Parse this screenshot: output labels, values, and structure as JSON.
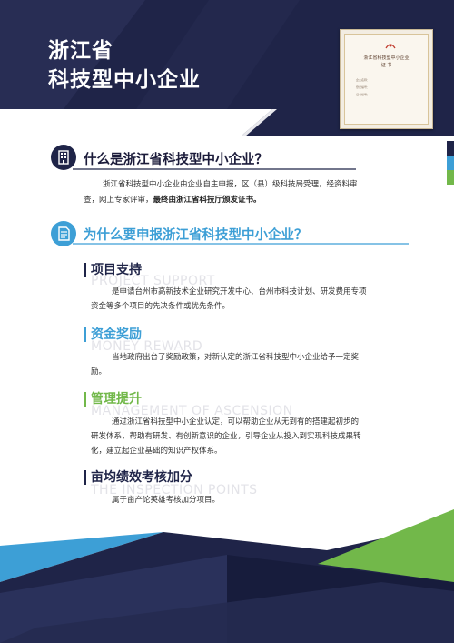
{
  "header": {
    "title_line1": "浙江省",
    "title_line2": "科技型中小企业"
  },
  "certificate": {
    "title": "浙江省科技型中小企业",
    "subtitle": "证 书",
    "line1_label": "企业名称：",
    "line2_label": "登记编号：",
    "line3_label": "证书编号："
  },
  "section1": {
    "heading": "什么是浙江省科技型中小企业？",
    "body_line1": "浙江省科技型中小企业由企业自主申报，区（县）级科技局受理，经资料审",
    "body_line2_prefix": "查，网上专家评审，",
    "body_line2_bold": "最终由浙江省科技厅颁发证书。"
  },
  "section2": {
    "heading": "为什么要申报浙江省科技型中小企业？",
    "items": [
      {
        "title": "项目支持",
        "ghost": "PROJECT SUPPORT",
        "lines": [
          "是申请台州市高新技术企业研究开发中心、台州市科技计划、研发费用专项",
          "资金等多个项目的先决条件或优先条件。"
        ]
      },
      {
        "title": "资金奖励",
        "ghost": "MONEY REWARD",
        "lines": [
          "当地政府出台了奖励政策，对新认定的浙江省科技型中小企业给予一定奖",
          "励。"
        ]
      },
      {
        "title": "管理提升",
        "ghost": "MANAGEMENT OF ASCENSION",
        "lines": [
          "通过浙江省科技型中小企业认定，可以帮助企业从无到有的搭建起初步的",
          "研发体系，帮助有研发、有创新意识的企业，引导企业从投入到实现科技成果转",
          "化，建立起企业基础的知识产权体系。"
        ]
      },
      {
        "title": "亩均绩效考核加分",
        "ghost": "THE INSPECTION POINTS",
        "lines": [
          "属于亩产论英雄考核加分项目。"
        ]
      }
    ]
  },
  "colors": {
    "navy": "#1f2448",
    "blue": "#3d9fd6",
    "green": "#72b84a",
    "dark_text": "#1b1b3a"
  },
  "icons": [
    "building-icon",
    "document-icon"
  ]
}
